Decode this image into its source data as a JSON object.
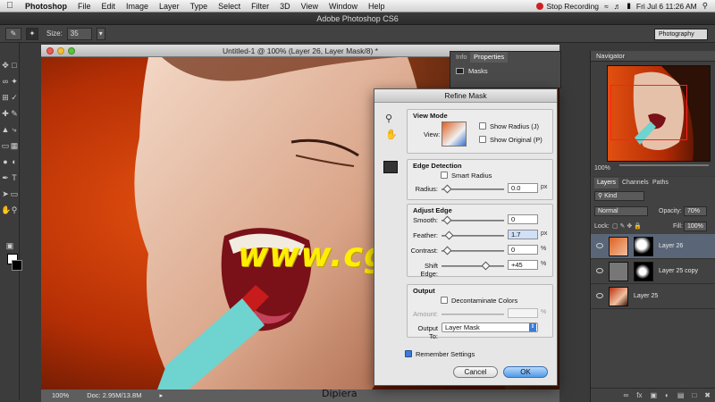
{
  "menubar": {
    "app_name": "Photoshop",
    "items": [
      "File",
      "Edit",
      "Image",
      "Layer",
      "Type",
      "Select",
      "Filter",
      "3D",
      "View",
      "Window",
      "Help"
    ],
    "stop_recording": "Stop Recording",
    "clock": "Fri Jul 6  11:26 AM"
  },
  "app_title": "Adobe Photoshop CS6",
  "options_bar": {
    "size_label": "Size:",
    "size_value": "35",
    "workspace": "Photography"
  },
  "document": {
    "title": "Untitled-1 @ 100% (Layer 26, Layer Mask/8) *",
    "zoom": "100%",
    "doc_size": "Doc: 2.95M/13.8M"
  },
  "properties_panel": {
    "tab_info": "Info",
    "tab_properties": "Properties",
    "masks_label": "Masks"
  },
  "refine_mask": {
    "title": "Refine Mask",
    "view_mode": {
      "heading": "View Mode",
      "view_label": "View:",
      "show_radius": "Show Radius (J)",
      "show_original": "Show Original (P)"
    },
    "edge_detection": {
      "heading": "Edge Detection",
      "smart_radius": "Smart Radius",
      "radius_label": "Radius:",
      "radius_value": "0.0",
      "radius_unit": "px"
    },
    "adjust_edge": {
      "heading": "Adjust Edge",
      "smooth_label": "Smooth:",
      "smooth_value": "0",
      "feather_label": "Feather:",
      "feather_value": "1.7",
      "feather_unit": "px",
      "contrast_label": "Contrast:",
      "contrast_value": "0",
      "contrast_unit": "%",
      "shift_label": "Shift Edge:",
      "shift_value": "+45",
      "shift_unit": "%"
    },
    "output": {
      "heading": "Output",
      "decontaminate": "Decontaminate Colors",
      "amount_label": "Amount:",
      "amount_unit": "%",
      "output_to_label": "Output To:",
      "output_to_value": "Layer Mask"
    },
    "remember": "Remember Settings",
    "cancel": "Cancel",
    "ok": "OK"
  },
  "navigator": {
    "title": "Navigator",
    "zoom": "100%"
  },
  "layers_panel": {
    "tabs": [
      "Layers",
      "Channels",
      "Paths"
    ],
    "kind": "Kind",
    "blend_mode": "Normal",
    "opacity_label": "Opacity:",
    "opacity_value": "70%",
    "lock_label": "Lock:",
    "fill_label": "Fill:",
    "fill_value": "100%",
    "layers": [
      "Layer 26",
      "Layer 25 copy",
      "Layer 25"
    ]
  },
  "watermark": "www.cgtsj.com",
  "caption": "Dipiera",
  "colors": {
    "ok_button": "#4f9ae8",
    "nav_view_box": "#ff2020",
    "watermark": "#ffee00"
  }
}
